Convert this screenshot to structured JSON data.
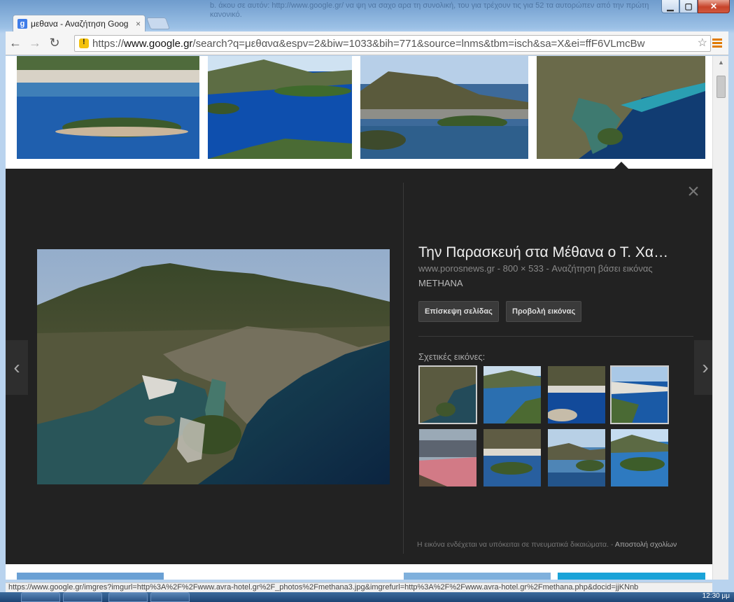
{
  "window": {
    "controls": {
      "minimize": "▁",
      "maximize": "▢",
      "close": "✕"
    },
    "background_text": "b. άκου σε αυτόν: http://www.google.gr/ να ψη να σαχο αρα\nτη συνολική, του για τρέχουν τις για 52\nτα αυτορώπεν από την πρώτη κανονικό."
  },
  "tab": {
    "favicon": "g",
    "title": "μεθανα - Αναζήτηση Goog",
    "close": "×"
  },
  "toolbar": {
    "back": "←",
    "forward": "→",
    "reload": "↻",
    "url_scheme": "https://",
    "url_host": "www.google.gr",
    "url_rest": "/search?q=μεθανα&espv=2&biw=1033&bih=771&source=lnms&tbm=isch&sa=X&ei=ffF6VLmcBw",
    "star": "☆"
  },
  "preview": {
    "close": "×",
    "prev": "‹",
    "next": "›",
    "title": "Την Παρασκευή στα Μέθανα ο Τ. Χα…",
    "meta": "www.porosnews.gr  -  800 × 533  -  Αναζήτηση βάσει εικόνας",
    "caption": "METHANA",
    "visit_button": "Επίσκεψη σελίδας",
    "view_button": "Προβολή εικόνας",
    "related_label": "Σχετικές εικόνες:",
    "footer": "Η εικόνα ενδέχεται να υπόκειται σε πνευματικά δικαιώματα.",
    "footer_sep": " - ",
    "feedback": "Αποστολή σχολίων"
  },
  "status_bar": {
    "url": "https://www.google.gr/imgres?imgurl=http%3A%2F%2Fwww.avra-hotel.gr%2F_photos%2Fmethana3.jpg&imgrefurl=http%3A%2F%2Fwww.avra-hotel.gr%2Fmethana.php&docid=jjKNnb"
  },
  "taskbar": {
    "clock": "12:30 μμ"
  },
  "colors": {
    "panel_bg": "#222222",
    "accent_sea": "#0e3f97"
  }
}
